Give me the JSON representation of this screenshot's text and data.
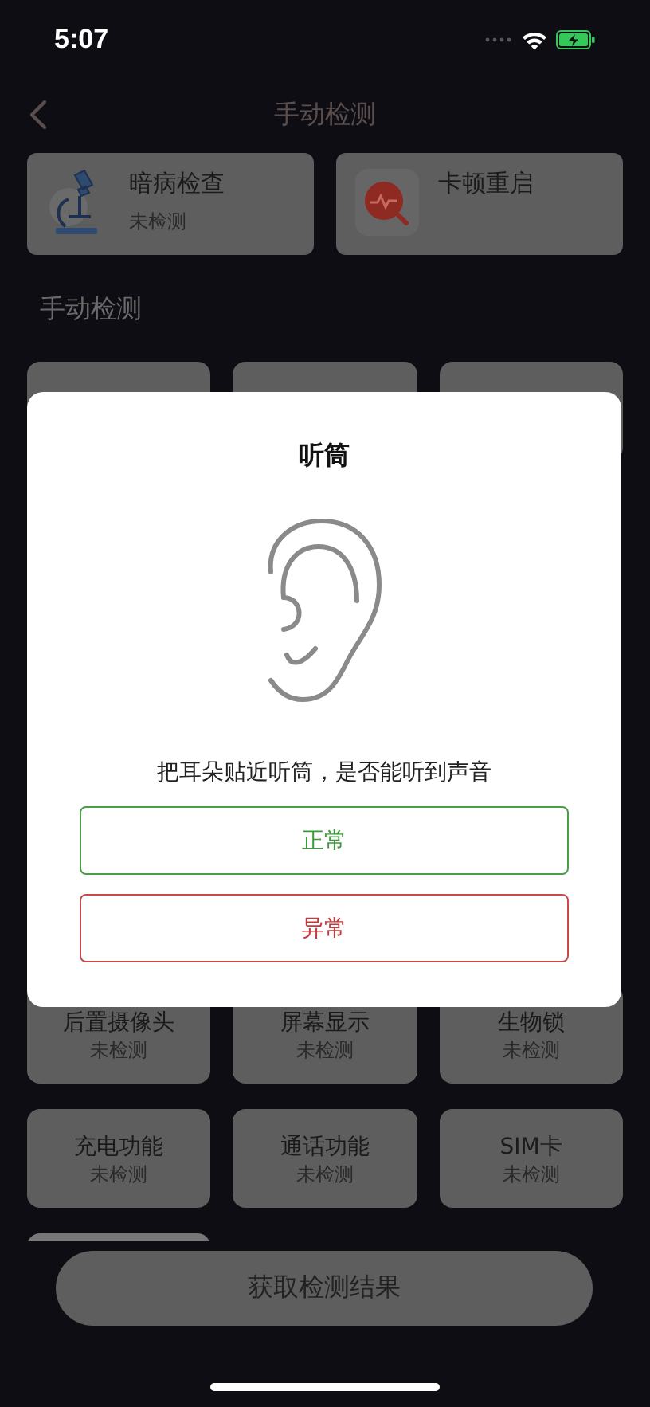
{
  "status_bar": {
    "time": "5:07"
  },
  "nav": {
    "title": "手动检测"
  },
  "top_cards": [
    {
      "title": "暗病检查",
      "status": "未检测"
    },
    {
      "title": "卡顿重启"
    }
  ],
  "section_title": "手动检测",
  "upper_row": [
    {
      "kind": "card"
    },
    {
      "kind": "card"
    },
    {
      "kind": "card"
    }
  ],
  "lower_rows": [
    {
      "name": "后置摄像头",
      "status": "未检测"
    },
    {
      "name": "屏幕显示",
      "status": "未检测"
    },
    {
      "name": "生物锁",
      "status": "未检测"
    },
    {
      "name": "充电功能",
      "status": "未检测"
    },
    {
      "name": "通话功能",
      "status": "未检测"
    },
    {
      "name": "SIM卡",
      "status": "未检测"
    }
  ],
  "action_button": "获取检测结果",
  "dialog": {
    "title": "听筒",
    "message": "把耳朵贴近听筒，是否能听到声音",
    "options": [
      {
        "label": "正常",
        "kind": "pass"
      },
      {
        "label": "异常",
        "kind": "fail"
      }
    ]
  }
}
